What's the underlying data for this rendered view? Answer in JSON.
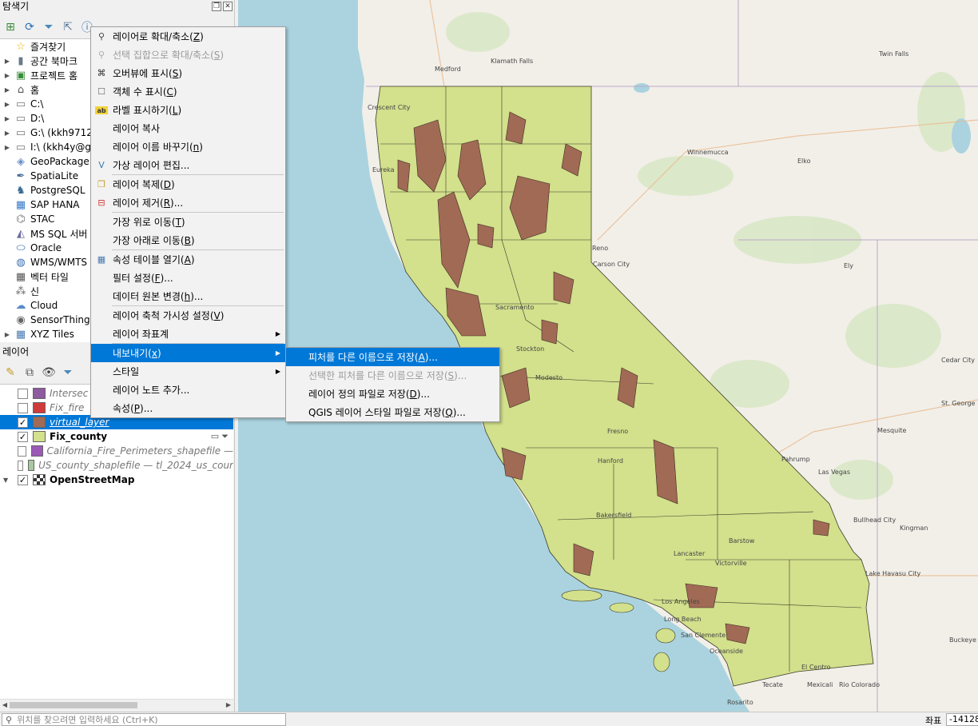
{
  "browser": {
    "title": "탐색기",
    "items": [
      {
        "label": "즐겨찾기",
        "icon": "star-icon",
        "arrow": false
      },
      {
        "label": "공간 북마크",
        "icon": "bookmark-icon",
        "arrow": true
      },
      {
        "label": "프로젝트 홈",
        "icon": "project-home-icon",
        "arrow": true
      },
      {
        "label": "홈",
        "icon": "home-icon",
        "arrow": true
      },
      {
        "label": "C:\\",
        "icon": "folder-icon",
        "arrow": true
      },
      {
        "label": "D:\\",
        "icon": "folder-icon",
        "arrow": true
      },
      {
        "label": "G:\\ (kkh9712",
        "icon": "folder-icon",
        "arrow": true
      },
      {
        "label": "I:\\ (kkh4y@g",
        "icon": "folder-icon",
        "arrow": true
      },
      {
        "label": "GeoPackage",
        "icon": "geopackage-icon",
        "arrow": false
      },
      {
        "label": "SpatiaLite",
        "icon": "spatialite-icon",
        "arrow": false
      },
      {
        "label": "PostgreSQL",
        "icon": "postgresql-icon",
        "arrow": false
      },
      {
        "label": "SAP HANA",
        "icon": "sap-hana-icon",
        "arrow": false
      },
      {
        "label": "STAC",
        "icon": "stac-icon",
        "arrow": false
      },
      {
        "label": "MS SQL 서버",
        "icon": "mssql-icon",
        "arrow": false
      },
      {
        "label": "Oracle",
        "icon": "oracle-icon",
        "arrow": false
      },
      {
        "label": "WMS/WMTS",
        "icon": "wms-icon",
        "arrow": false
      },
      {
        "label": "벡터 타일",
        "icon": "vector-tile-icon",
        "arrow": false
      },
      {
        "label": "신",
        "icon": "scene-icon",
        "arrow": false
      },
      {
        "label": "Cloud",
        "icon": "cloud-icon",
        "arrow": false
      },
      {
        "label": "SensorThings",
        "icon": "sensorthings-icon",
        "arrow": false
      },
      {
        "label": "XYZ Tiles",
        "icon": "xyz-tiles-icon",
        "arrow": true
      }
    ]
  },
  "layers": {
    "title": "레이어",
    "items": [
      {
        "label": "Intersec",
        "color": "#8e5aa0",
        "checked": false,
        "style": "italic"
      },
      {
        "label": "Fix_fire",
        "color": "#cf3b3b",
        "checked": false,
        "style": "italic"
      },
      {
        "label": "virtual_layer",
        "color": "#a06a55",
        "checked": true,
        "style": "selected"
      },
      {
        "label": "Fix_county",
        "color": "#d3e08c",
        "checked": true,
        "style": "bold"
      },
      {
        "label": "California_Fire_Perimeters_shapefile —",
        "color": "#9b59b6",
        "checked": false,
        "style": "italic"
      },
      {
        "label": "US_county_shaplefile — tl_2024_us_cour",
        "color": "#a8c8a0",
        "checked": false,
        "style": "italic"
      },
      {
        "label": "OpenStreetMap",
        "color": "",
        "checked": true,
        "style": "bold"
      }
    ]
  },
  "context_menu": {
    "items": [
      {
        "label": "레이어로 확대/축소(",
        "key": "Z",
        "tail": ")",
        "icon": "zoom-to-layer-icon",
        "disabled": false
      },
      {
        "label": "선택 집합으로 확대/축소(",
        "key": "S",
        "tail": ")",
        "icon": "zoom-selection-icon",
        "disabled": true
      },
      {
        "label": "오버뷰에 표시(",
        "key": "S",
        "tail": ")",
        "icon": "overview-icon",
        "disabled": false
      },
      {
        "label": "객체 수 표시(",
        "key": "C",
        "tail": ")",
        "icon": "checkbox-icon",
        "disabled": false
      },
      {
        "label": "라벨 표시하기(",
        "key": "L",
        "tail": ")",
        "icon": "labels-icon",
        "disabled": false
      },
      {
        "label": "레이어 복사",
        "key": "",
        "tail": "",
        "icon": "",
        "disabled": false
      },
      {
        "label": "레이어 이름 바꾸기(",
        "key": "n",
        "tail": ")",
        "icon": "",
        "disabled": false
      },
      {
        "label": "가상 레이어 편집...",
        "key": "",
        "tail": "",
        "icon": "virtual-layer-icon",
        "disabled": false,
        "sep_after": true
      },
      {
        "label": "레이어 복제(",
        "key": "D",
        "tail": ")",
        "icon": "duplicate-icon",
        "disabled": false
      },
      {
        "label": "레이어 제거(",
        "key": "R",
        "tail": ")...",
        "icon": "remove-layer-icon",
        "disabled": false,
        "sep_after": true
      },
      {
        "label": "가장 위로 이동(",
        "key": "T",
        "tail": ")",
        "icon": "",
        "disabled": false
      },
      {
        "label": "가장 아래로 이동(",
        "key": "B",
        "tail": ")",
        "icon": "",
        "disabled": false,
        "sep_after": true
      },
      {
        "label": "속성 테이블 열기(",
        "key": "A",
        "tail": ")",
        "icon": "attribute-table-icon",
        "disabled": false
      },
      {
        "label": "필터 설정(",
        "key": "F",
        "tail": ")...",
        "icon": "",
        "disabled": false
      },
      {
        "label": "데이터 원본 변경(",
        "key": "h",
        "tail": ")...",
        "icon": "",
        "disabled": false,
        "sep_after": true
      },
      {
        "label": "레이어 축척 가시성 설정(",
        "key": "V",
        "tail": ")",
        "icon": "",
        "disabled": false
      },
      {
        "label": "레이어 좌표계",
        "key": "",
        "tail": "",
        "icon": "",
        "disabled": false,
        "submenu": true,
        "sep_after": true
      },
      {
        "label": "내보내기(",
        "key": "x",
        "tail": ")",
        "icon": "",
        "disabled": false,
        "submenu": true,
        "highlight": true
      },
      {
        "label": "스타일",
        "key": "",
        "tail": "",
        "icon": "",
        "disabled": false,
        "submenu": true
      },
      {
        "label": "레이어 노트 추가...",
        "key": "",
        "tail": "",
        "icon": "",
        "disabled": false
      },
      {
        "label": "속성(",
        "key": "P",
        "tail": ")...",
        "icon": "",
        "disabled": false
      }
    ]
  },
  "export_submenu": {
    "items": [
      {
        "label": "피처를 다른 이름으로 저장(",
        "key": "A",
        "tail": ")...",
        "disabled": false,
        "highlight": true
      },
      {
        "label": "선택한 피처를 다른 이름으로 저장(",
        "key": "S",
        "tail": ")...",
        "disabled": true
      },
      {
        "label": "레이어 정의 파일로 저장(",
        "key": "D",
        "tail": ")...",
        "disabled": false
      },
      {
        "label": "QGIS 레이어 스타일 파일로 저장(",
        "key": "Q",
        "tail": ")...",
        "disabled": false
      }
    ]
  },
  "map": {
    "labels": [
      "Crescent City",
      "Medford",
      "Klamath Falls",
      "Twin Falls",
      "Eureka",
      "Winnemucca",
      "Elko",
      "Reno",
      "Carson City",
      "Sacramento",
      "Stockton",
      "Modesto",
      "Ely",
      "Cedar City",
      "St. George",
      "Fresno",
      "Hanford",
      "Las Vegas",
      "Mesquite",
      "Pahrump",
      "Bakersfield",
      "Barstow",
      "Bullhead City",
      "Kingman",
      "Lake Havasu City",
      "Lancaster",
      "Victorville",
      "Los Angeles",
      "Long Beach",
      "San Clemente",
      "Oceanside",
      "El Centro",
      "Mexicali",
      "Rio Colorado",
      "Tecate",
      "Rosarito",
      "Buckeye"
    ],
    "colors": {
      "ocean": "#aad3df",
      "land": "#f2efe9",
      "county": "#d3e08c",
      "fire": "#a06a55"
    }
  },
  "statusbar": {
    "locator_placeholder": "위치를 찾으려면 입력하세요 (Ctrl+K)",
    "coord_label": "좌표",
    "coord_value": "-14128"
  }
}
